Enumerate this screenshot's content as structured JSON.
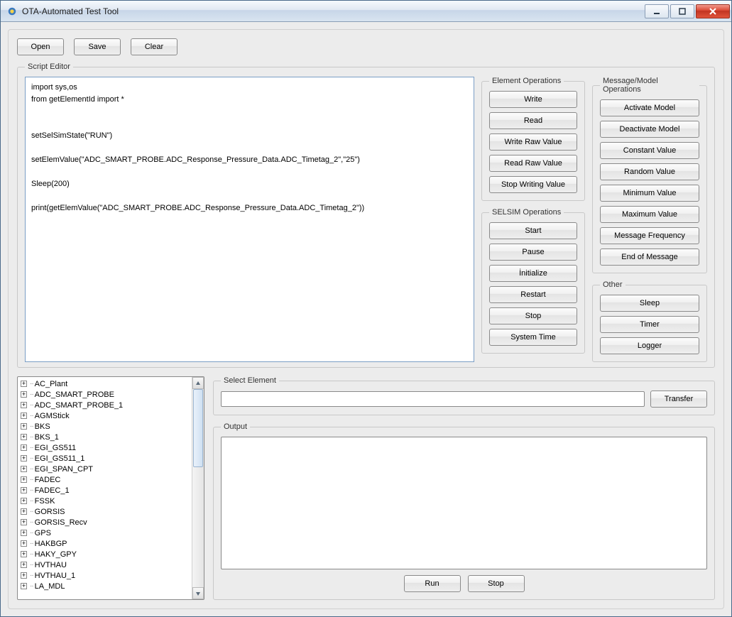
{
  "window": {
    "title": "OTA-Automated Test Tool"
  },
  "toolbar": {
    "open": "Open",
    "save": "Save",
    "clear": "Clear"
  },
  "script_editor": {
    "legend": "Script Editor",
    "content": "import sys,os\nfrom getElementId import *\n\n\nsetSelSimState(\"RUN\")\n\nsetElemValue(\"ADC_SMART_PROBE.ADC_Response_Pressure_Data.ADC_Timetag_2\",\"25\")\n\nSleep(200)\n\nprint(getElemValue(\"ADC_SMART_PROBE.ADC_Response_Pressure_Data.ADC_Timetag_2\"))"
  },
  "element_ops": {
    "legend": "Element Operations",
    "buttons": [
      "Write",
      "Read",
      "Write Raw Value",
      "Read Raw Value",
      "Stop Writing Value"
    ]
  },
  "selsim_ops": {
    "legend": "SELSIM Operations",
    "buttons": [
      "Start",
      "Pause",
      "İnitialize",
      "Restart",
      "Stop",
      "System Time"
    ]
  },
  "message_ops": {
    "legend": "Message/Model Operations",
    "buttons": [
      "Activate Model",
      "Deactivate Model",
      "Constant Value",
      "Random Value",
      "Minimum Value",
      "Maximum Value",
      "Message Frequency",
      "End of Message"
    ]
  },
  "other_ops": {
    "legend": "Other",
    "buttons": [
      "Sleep",
      "Timer",
      "Logger"
    ]
  },
  "tree": {
    "items": [
      "AC_Plant",
      "ADC_SMART_PROBE",
      "ADC_SMART_PROBE_1",
      "AGMStick",
      "BKS",
      "BKS_1",
      "EGI_GS511",
      "EGI_GS511_1",
      "EGI_SPAN_CPT",
      "FADEC",
      "FADEC_1",
      "FSSK",
      "GORSIS",
      "GORSIS_Recv",
      "GPS",
      "HAKBGP",
      "HAKY_GPY",
      "HVTHAU",
      "HVTHAU_1",
      "LA_MDL"
    ]
  },
  "select_element": {
    "legend": "Select Element",
    "value": "",
    "transfer": "Transfer"
  },
  "output": {
    "legend": "Output",
    "run": "Run",
    "stop": "Stop"
  }
}
